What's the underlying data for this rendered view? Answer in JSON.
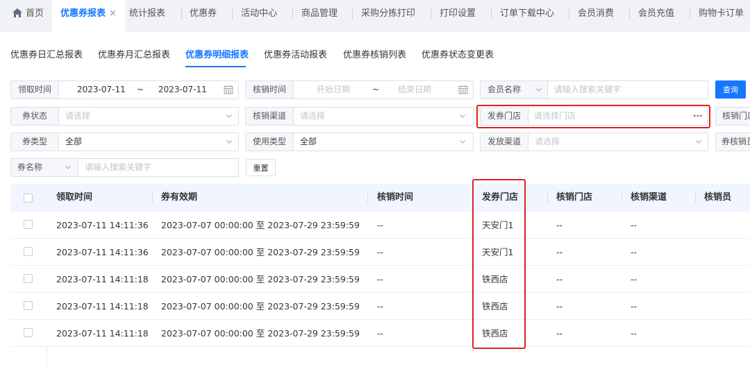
{
  "top_tabs": {
    "home": "首页",
    "active": "优惠券报表",
    "active_close": "×",
    "items": [
      "统计报表",
      "优惠券",
      "活动中心",
      "商品管理",
      "采购分拣打印",
      "打印设置",
      "订单下载中心",
      "会员消费",
      "会员充值",
      "购物卡订单"
    ]
  },
  "sub_tabs": {
    "items": [
      "优惠券日汇总报表",
      "优惠券月汇总报表",
      "优惠券明细报表",
      "优惠券活动报表",
      "优惠券核销列表",
      "优惠券状态变更表"
    ],
    "active_index": 2
  },
  "filters": {
    "receive_time": {
      "label": "领取时间",
      "start": "2023-07-11",
      "sep": "~",
      "end": "2023-07-11"
    },
    "verify_time": {
      "label": "核销时间",
      "start_placeholder": "开始日期",
      "sep": "~",
      "end_placeholder": "结束日期"
    },
    "member": {
      "select": "会员名称",
      "placeholder": "请输入搜索关键字"
    },
    "coupon_status": {
      "label": "券状态",
      "placeholder": "请选择"
    },
    "verify_channel": {
      "label": "核销渠道",
      "placeholder": "请选择"
    },
    "issue_store": {
      "label": "发券门店",
      "placeholder": "请选择门店",
      "more": "···"
    },
    "verify_store_partial": "核销门店",
    "coupon_type": {
      "label": "券类型",
      "value": "全部"
    },
    "use_type": {
      "label": "使用类型",
      "value": "全部"
    },
    "issue_channel": {
      "label": "发放渠道",
      "placeholder": "请选择"
    },
    "verify_staff_partial": "券核销员",
    "coupon_name": {
      "select": "券名称",
      "placeholder": "请输入搜索关键字"
    },
    "query_button": "查询",
    "reset_button": "重置"
  },
  "table": {
    "headers": [
      "领取时间",
      "券有效期",
      "核销时间",
      "发券门店",
      "核销门店",
      "核销渠道",
      "核销员"
    ],
    "rows": [
      [
        "2023-07-11 14:11:36",
        "2023-07-07 00:00:00 至 2023-07-29 23:59:59",
        "--",
        "天安门1",
        "--",
        "--"
      ],
      [
        "2023-07-11 14:11:36",
        "2023-07-07 00:00:00 至 2023-07-29 23:59:59",
        "--",
        "天安门1",
        "--",
        "--"
      ],
      [
        "2023-07-11 14:11:18",
        "2023-07-07 00:00:00 至 2023-07-29 23:59:59",
        "--",
        "铁西店",
        "--",
        "--"
      ],
      [
        "2023-07-11 14:11:18",
        "2023-07-07 00:00:00 至 2023-07-29 23:59:59",
        "--",
        "铁西店",
        "--",
        "--"
      ],
      [
        "2023-07-11 14:11:18",
        "2023-07-07 00:00:00 至 2023-07-29 23:59:59",
        "--",
        "铁西店",
        "--",
        "--"
      ]
    ]
  },
  "colors": {
    "accent": "#1677ff",
    "highlight": "#e02020",
    "header_bg": "#f0f5ff"
  }
}
